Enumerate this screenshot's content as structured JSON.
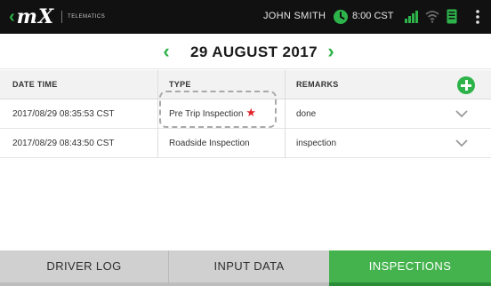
{
  "topbar": {
    "logo_text": "mX",
    "logo_subtext": "TELEMATICS",
    "username": "JOHN SMITH",
    "time": "8:00 CST",
    "icons": {
      "clock": "clock-icon",
      "signal": "signal-icon",
      "wifi": "wifi-icon",
      "device": "tablet-icon",
      "menu": "menu-icon"
    }
  },
  "date_nav": {
    "date": "29 AUGUST 2017",
    "prev_label": "‹",
    "next_label": "›"
  },
  "table": {
    "headers": [
      "DATE TIME",
      "TYPE",
      "REMARKS"
    ],
    "rows": [
      {
        "datetime": "2017/08/29 08:35:53 CST",
        "type": "Pre Trip Inspection",
        "required": "★",
        "remarks": "done"
      },
      {
        "datetime": "2017/08/29 08:43:50 CST",
        "type": "Roadside Inspection",
        "remarks": "inspection"
      }
    ]
  },
  "tabs": {
    "driver_log": "DRIVER LOG",
    "input_data": "INPUT DATA",
    "inspections": "INSPECTIONS",
    "active": "inspections"
  },
  "colors": {
    "accent": "#2db34a",
    "topbar_bg": "#111111",
    "required_star": "#e0242b",
    "tab_inactive": "#d0d0d0"
  }
}
